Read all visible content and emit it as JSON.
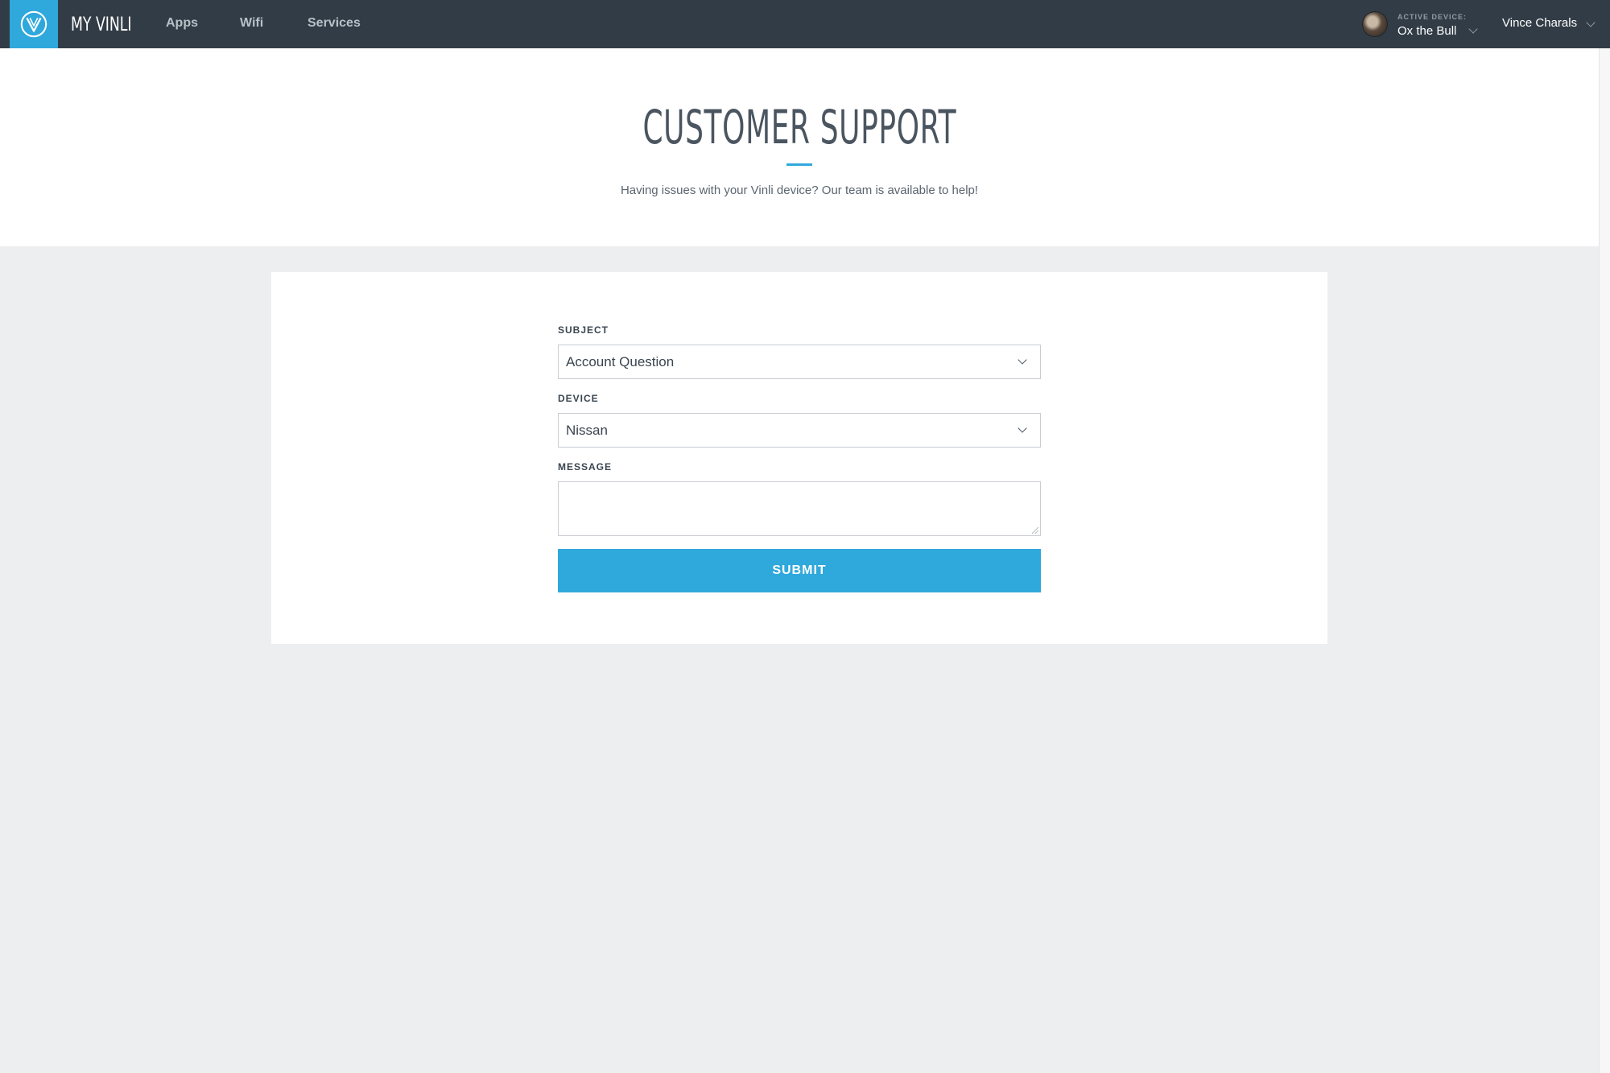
{
  "nav": {
    "brand": "MY VINLI",
    "links": [
      {
        "label": "Apps"
      },
      {
        "label": "Wifi"
      },
      {
        "label": "Services"
      }
    ],
    "active_device_label": "ACTIVE DEVICE:",
    "active_device_name": "Ox the Bull",
    "user_name": "Vince Charals"
  },
  "hero": {
    "title": "CUSTOMER SUPPORT",
    "subtitle": "Having issues with your Vinli device? Our team is available to help!"
  },
  "form": {
    "subject_label": "SUBJECT",
    "subject_value": "Account Question",
    "device_label": "DEVICE",
    "device_value": "Nissan",
    "message_label": "MESSAGE",
    "message_value": "",
    "submit_label": "SUBMIT"
  },
  "colors": {
    "accent": "#2fa8dc",
    "nav_bg": "#323c46",
    "page_bg": "#edeef0"
  }
}
